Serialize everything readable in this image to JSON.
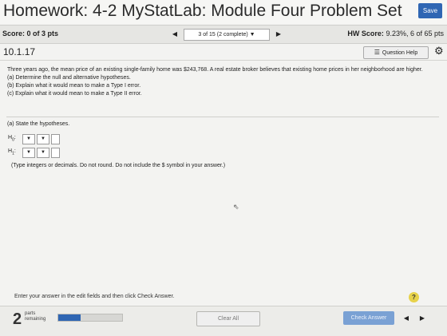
{
  "header": {
    "title": "Homework: 4-2 MyStatLab: Module Four Problem Set",
    "save_label": "Save"
  },
  "scorebar": {
    "score": "Score: 0 of 3 pts",
    "nav_prev": "◀",
    "nav_select": "3 of 15 (2 complete) ▼",
    "nav_next": "▶",
    "hw_score_label": "HW Score:",
    "hw_score_value": "9.23%, 6 of 65 pts"
  },
  "question": {
    "number": "10.1.17",
    "help_label": "Question Help",
    "help_icon": "list-icon",
    "gear_icon": "gear-icon"
  },
  "problem": {
    "intro": "Three years ago, the mean price of an existing single-family home was $243,768. A real estate broker believes that existing home prices in her neighborhood are higher.",
    "items": [
      "(a) Determine the null and alternative hypotheses.",
      "(b) Explain what it would mean to make a Type I error.",
      "(c) Explain what it would mean to make a Type II error."
    ]
  },
  "part_a": {
    "label": "(a) State the hypotheses.",
    "h0": "H",
    "h0_sub": "0",
    "h1": "H",
    "h1_sub": "1",
    "dropdown_glyph": "▼",
    "hint": "(Type integers or decimals. Do not round. Do not include the $ symbol in your answer.)"
  },
  "footer": {
    "instruction": "Enter your answer in the edit fields and then click Check Answer.",
    "help_glyph": "?",
    "parts_count": "2",
    "parts_line1": "parts",
    "parts_line2": "remaining",
    "progress": 0.35,
    "clear_label": "Clear All",
    "check_label": "Check Answer",
    "prev": "◀",
    "next": "▶"
  },
  "colors": {
    "accent": "#2f66b3",
    "help_yellow": "#e7d24a"
  }
}
